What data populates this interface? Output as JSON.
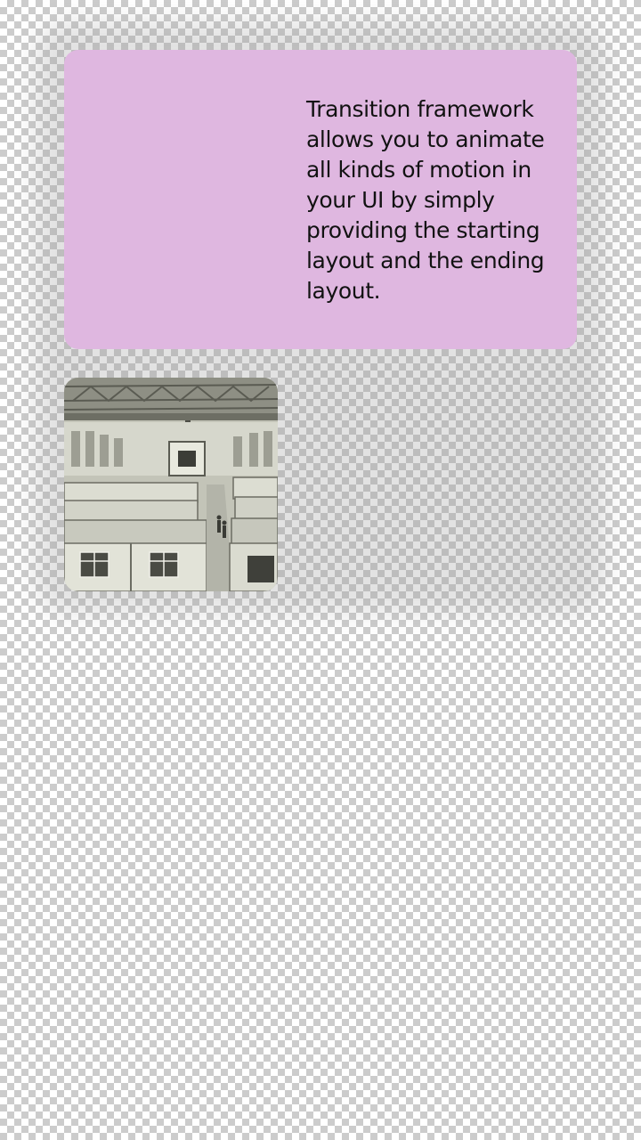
{
  "card": {
    "text": "Transition framework allows you to animate all kinds of motion in your UI by simply providing the starting layout and the ending layout.",
    "background": "#dfb7e0"
  },
  "image": {
    "subject": "factory-hall-modular-cabins-photo"
  }
}
